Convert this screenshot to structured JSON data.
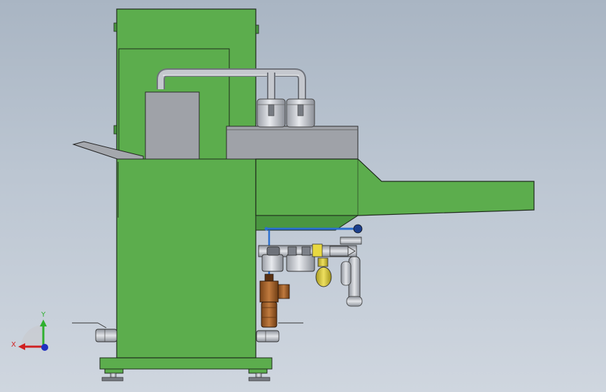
{
  "viewport": {
    "background_top": "#a9b5c3",
    "background_bottom": "#cfd6df"
  },
  "colors": {
    "frame_green": "#5cad4d",
    "frame_green_dark": "#4a9640",
    "outline": "#1e2a1c",
    "steel": "#c9ccd2",
    "steel_dark": "#8c9098",
    "panel_gray": "#9fa2a8",
    "valve_yellow": "#d8c838",
    "regulator_brown": "#a3612c",
    "air_line_blue": "#2a6fd0"
  },
  "triad": {
    "x_axis": {
      "label": "X",
      "color": "#d02020"
    },
    "y_axis": {
      "label": "Y",
      "color": "#2fb02f"
    },
    "z_axis": {
      "color": "#2030c0"
    },
    "origin_icon": "triad-origin-icon"
  }
}
